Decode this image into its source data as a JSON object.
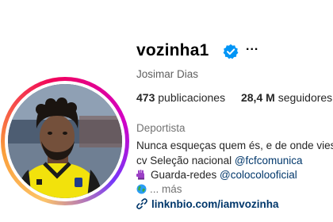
{
  "profile": {
    "username": "vozinha1",
    "more_label": "...",
    "full_name": "Josimar Dias"
  },
  "stats": {
    "posts_count": "473",
    "posts_label": "publicaciones",
    "followers_count": "28,4 M",
    "followers_label": "seguidores"
  },
  "bio": {
    "category": "Deportista",
    "line1": "Nunca esqueças quem és, e de onde vies",
    "line2_prefix": "cv Seleção nacional ",
    "line2_mention": "@fcfcomunica",
    "line3_prefix": "Guarda-redes ",
    "line3_mention": "@colocolooficial",
    "more_label": "... más",
    "link": "linknbio.com/iamvozinha"
  },
  "icons": {
    "verified": "verified-badge-icon",
    "glove": "goalkeeper-glove-emoji",
    "globe": "globe-emoji",
    "link": "link-icon"
  },
  "colors": {
    "verified_blue": "#0095f6",
    "mention_blue": "#00376b",
    "jersey_yellow": "#f2e20c"
  }
}
